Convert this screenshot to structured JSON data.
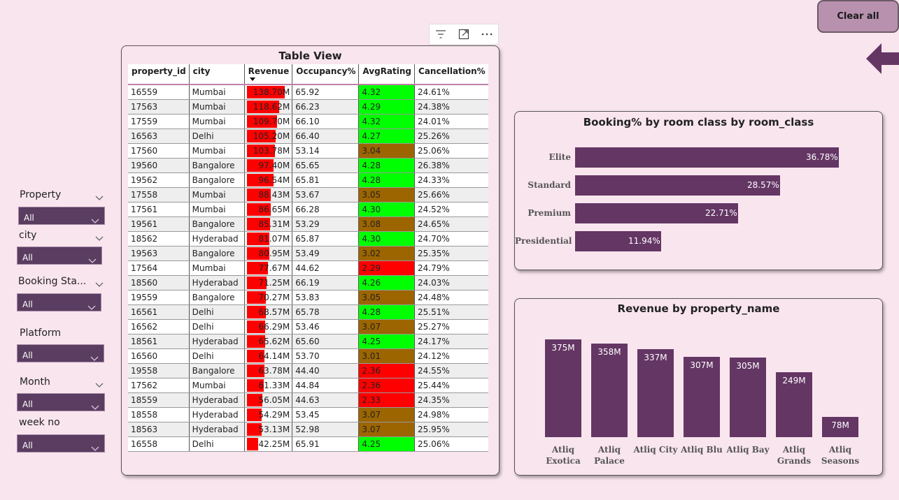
{
  "toolbar": {
    "clear_all_label": "Clear all"
  },
  "slicers": [
    {
      "label": "Property",
      "value": "All"
    },
    {
      "label": "city",
      "value": "All"
    },
    {
      "label": "Booking Sta...",
      "value": "All"
    },
    {
      "label": "Platform",
      "value": "All"
    },
    {
      "label": "Month",
      "value": "All"
    },
    {
      "label": "week no",
      "value": "All"
    }
  ],
  "table_view": {
    "title": "Table View",
    "columns": [
      "property_id",
      "city",
      "Revenue",
      "Occupancy%",
      "AvgRating",
      "Cancellation%"
    ],
    "rows": [
      [
        "16559",
        "Mumbai",
        "138.70M",
        "65.92",
        "4.32",
        "24.61%"
      ],
      [
        "17563",
        "Mumbai",
        "118.62M",
        "66.23",
        "4.29",
        "24.38%"
      ],
      [
        "17559",
        "Mumbai",
        "109.70M",
        "66.10",
        "4.32",
        "24.01%"
      ],
      [
        "16563",
        "Delhi",
        "105.20M",
        "66.40",
        "4.27",
        "25.26%"
      ],
      [
        "17560",
        "Mumbai",
        "103.78M",
        "53.14",
        "3.04",
        "25.06%"
      ],
      [
        "19560",
        "Bangalore",
        "97.40M",
        "65.65",
        "4.28",
        "26.38%"
      ],
      [
        "19562",
        "Bangalore",
        "96.54M",
        "65.81",
        "4.28",
        "24.33%"
      ],
      [
        "17558",
        "Mumbai",
        "88.43M",
        "53.67",
        "3.05",
        "25.66%"
      ],
      [
        "17561",
        "Mumbai",
        "86.65M",
        "66.28",
        "4.30",
        "24.52%"
      ],
      [
        "19561",
        "Bangalore",
        "85.31M",
        "53.29",
        "3.08",
        "24.65%"
      ],
      [
        "18562",
        "Hyderabad",
        "81.07M",
        "65.87",
        "4.30",
        "24.70%"
      ],
      [
        "19563",
        "Bangalore",
        "80.95M",
        "53.49",
        "3.02",
        "25.35%"
      ],
      [
        "17564",
        "Mumbai",
        "77.67M",
        "44.62",
        "2.29",
        "24.79%"
      ],
      [
        "18560",
        "Hyderabad",
        "71.25M",
        "66.19",
        "4.26",
        "24.03%"
      ],
      [
        "19559",
        "Bangalore",
        "70.27M",
        "53.83",
        "3.05",
        "24.48%"
      ],
      [
        "16561",
        "Delhi",
        "68.57M",
        "65.78",
        "4.28",
        "25.51%"
      ],
      [
        "16562",
        "Delhi",
        "66.29M",
        "53.46",
        "3.07",
        "25.27%"
      ],
      [
        "18561",
        "Hyderabad",
        "65.62M",
        "65.60",
        "4.25",
        "24.17%"
      ],
      [
        "16560",
        "Delhi",
        "64.14M",
        "53.70",
        "3.01",
        "24.12%"
      ],
      [
        "19558",
        "Bangalore",
        "63.78M",
        "44.40",
        "2.36",
        "24.55%"
      ],
      [
        "17562",
        "Mumbai",
        "61.33M",
        "44.84",
        "2.36",
        "25.44%"
      ],
      [
        "18559",
        "Hyderabad",
        "56.05M",
        "44.63",
        "2.33",
        "24.35%"
      ],
      [
        "18558",
        "Hyderabad",
        "54.29M",
        "53.45",
        "3.07",
        "24.98%"
      ],
      [
        "18563",
        "Hyderabad",
        "53.13M",
        "52.98",
        "3.07",
        "25.95%"
      ],
      [
        "16558",
        "Delhi",
        "42.25M",
        "65.91",
        "4.25",
        "25.06%"
      ]
    ],
    "revenue_values": [
      138.7,
      118.62,
      109.7,
      105.2,
      103.78,
      97.4,
      96.54,
      88.43,
      86.65,
      85.31,
      81.07,
      80.95,
      77.67,
      71.25,
      70.27,
      68.57,
      66.29,
      65.62,
      64.14,
      63.78,
      61.33,
      56.05,
      54.29,
      53.13,
      42.25
    ]
  },
  "colors": {
    "bar_purple": "#643664",
    "revenue_bar": "#ff0000",
    "rating_high": "#00ff00",
    "rating_mid": "#9c6500",
    "rating_low": "#ff0000"
  },
  "chart_data": [
    {
      "type": "bar",
      "orientation": "horizontal",
      "title": "Booking% by room class by room_class",
      "categories": [
        "Elite",
        "Standard",
        "Premium",
        "Presidential"
      ],
      "values": [
        36.78,
        28.57,
        22.71,
        11.94
      ],
      "value_labels": [
        "36.78%",
        "28.57%",
        "22.71%",
        "11.94%"
      ],
      "xlim": [
        0,
        38
      ]
    },
    {
      "type": "bar",
      "orientation": "vertical",
      "title": "Revenue by property_name",
      "categories": [
        [
          "Atliq",
          "Exotica"
        ],
        [
          "Atliq",
          "Palace"
        ],
        [
          "Atliq City"
        ],
        [
          "Atliq Blu"
        ],
        [
          "Atliq Bay"
        ],
        [
          "Atliq",
          "Grands"
        ],
        [
          "Atliq",
          "Seasons"
        ]
      ],
      "values": [
        375,
        358,
        337,
        307,
        305,
        249,
        78
      ],
      "value_labels": [
        "375M",
        "358M",
        "337M",
        "307M",
        "305M",
        "249M",
        "78M"
      ],
      "ylim": [
        0,
        375
      ]
    }
  ]
}
